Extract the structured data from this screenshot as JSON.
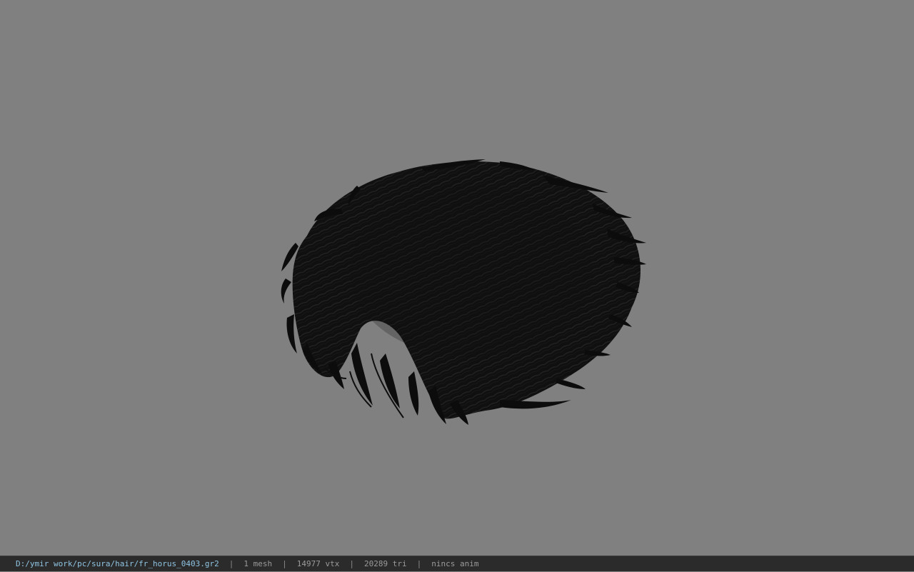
{
  "viewport": {
    "background": "#808080",
    "model_color": "#0e0e0e",
    "model_highlight": "#262626"
  },
  "statusbar": {
    "file_path": "D:/ymir work/pc/sura/hair/fr_horus_0403.gr2",
    "sep": "|",
    "mesh_count": "1 mesh",
    "vertex_count": "14977 vtx",
    "triangle_count": "20289 tri",
    "anim": "nincs anim",
    "path_color": "#8fc4e3",
    "bg_color": "#2b2b2b"
  }
}
